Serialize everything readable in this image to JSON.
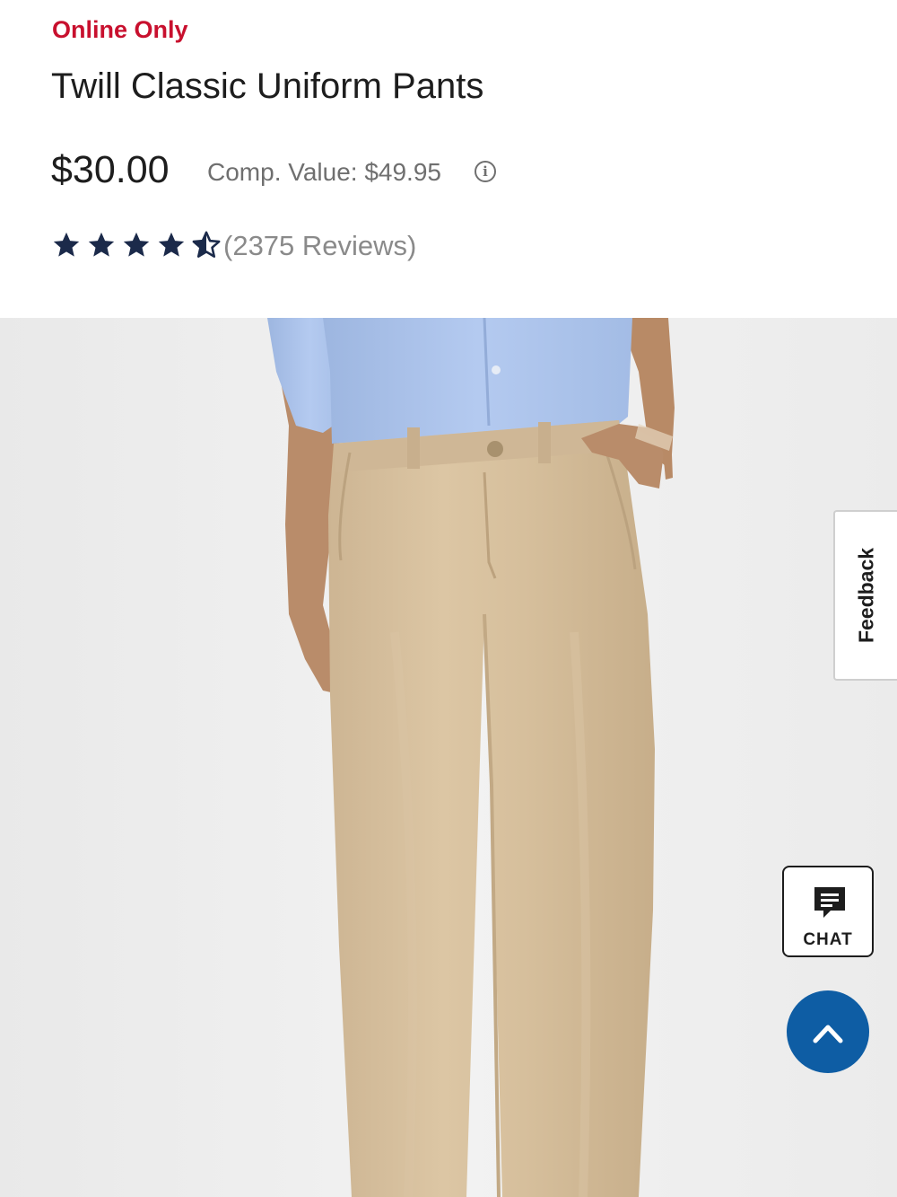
{
  "product": {
    "badge": "Online Only",
    "title": "Twill Classic Uniform Pants",
    "price": "$30.00",
    "comp_value": "Comp. Value: $49.95",
    "rating": 4.5,
    "rating_max": 5,
    "reviews": "(2375 Reviews)"
  },
  "icons": {
    "info": "info-icon",
    "star": "star-icon",
    "chat": "chat-bubble-icon",
    "back_to_top": "chevron-up-icon"
  },
  "feedback": {
    "label": "Feedback"
  },
  "chat": {
    "label": "CHAT"
  },
  "colors": {
    "badge": "#c8102e",
    "star": "#1b2a4a",
    "back_to_top": "#0e5da4",
    "pants": "#d9c2a0",
    "shirt": "#aec5ec"
  }
}
